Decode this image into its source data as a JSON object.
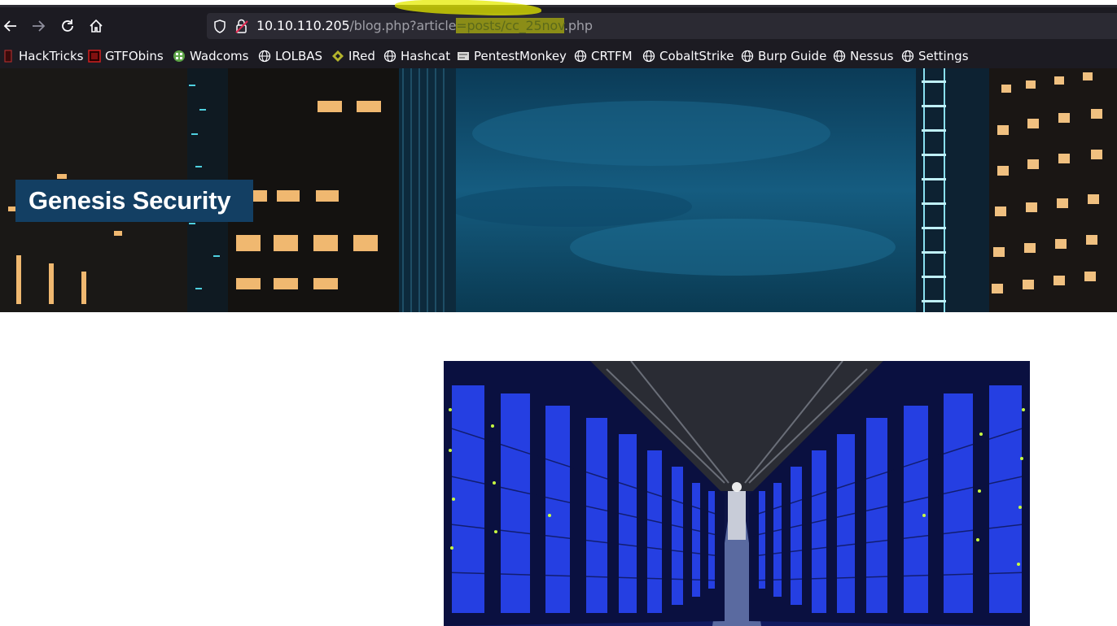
{
  "browser": {
    "url": {
      "host": "10.10.110.205",
      "path_before": "/blog.php?article",
      "param_value": "=posts/cc_25nov",
      "path_after": ".php"
    }
  },
  "bookmarks": [
    {
      "label": "HackTricks",
      "icon": "hacktricks-icon"
    },
    {
      "label": "GTFObins",
      "icon": "gtfobins-icon"
    },
    {
      "label": "Wadcoms",
      "icon": "wadcoms-icon"
    },
    {
      "label": "LOLBAS",
      "icon": "globe-icon"
    },
    {
      "label": "IRed",
      "icon": "ired-icon"
    },
    {
      "label": "Hashcat",
      "icon": "globe-icon"
    },
    {
      "label": "PentestMonkey",
      "icon": "pentestmonkey-icon"
    },
    {
      "label": "CRTFM",
      "icon": "globe-icon"
    },
    {
      "label": "CobaltStrike",
      "icon": "globe-icon"
    },
    {
      "label": "Burp Guide",
      "icon": "globe-icon"
    },
    {
      "label": "Nessus",
      "icon": "globe-icon"
    },
    {
      "label": "Settings",
      "icon": "globe-icon"
    }
  ],
  "site": {
    "title": "Genesis Security"
  },
  "colors": {
    "chrome_bg": "#1c1b22",
    "urlbar_bg": "#2b2a33",
    "title_box": "#133f63",
    "highlight": "#dbde00"
  }
}
